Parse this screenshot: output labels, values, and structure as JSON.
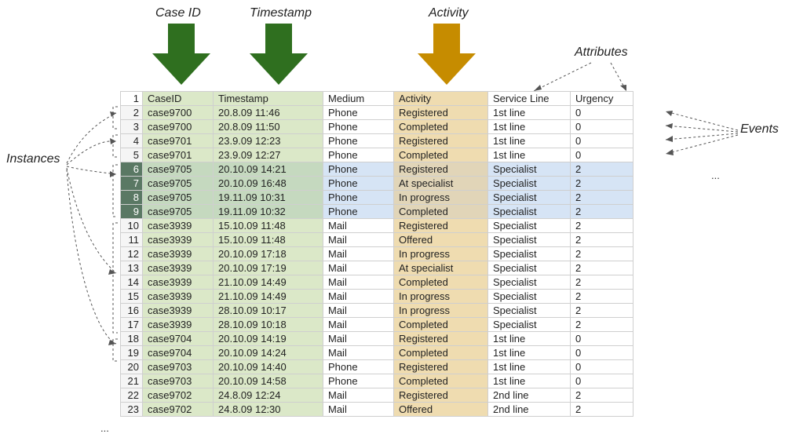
{
  "labels": {
    "case_id": "Case ID",
    "timestamp": "Timestamp",
    "activity": "Activity",
    "attributes": "Attributes",
    "instances": "Instances",
    "events": "Events",
    "ellipsis_left": "...",
    "ellipsis_right": "..."
  },
  "columns": {
    "rownum": "",
    "case": "CaseID",
    "ts": "Timestamp",
    "med": "Medium",
    "act": "Activity",
    "svc": "Service Line",
    "urg": "Urgency"
  },
  "rows": [
    {
      "n": 2,
      "case": "case9700",
      "ts": "20.8.09 11:46",
      "med": "Phone",
      "act": "Registered",
      "svc": "1st line",
      "urg": "0",
      "sel": false
    },
    {
      "n": 3,
      "case": "case9700",
      "ts": "20.8.09 11:50",
      "med": "Phone",
      "act": "Completed",
      "svc": "1st line",
      "urg": "0",
      "sel": false
    },
    {
      "n": 4,
      "case": "case9701",
      "ts": "23.9.09 12:23",
      "med": "Phone",
      "act": "Registered",
      "svc": "1st line",
      "urg": "0",
      "sel": false
    },
    {
      "n": 5,
      "case": "case9701",
      "ts": "23.9.09 12:27",
      "med": "Phone",
      "act": "Completed",
      "svc": "1st line",
      "urg": "0",
      "sel": false
    },
    {
      "n": 6,
      "case": "case9705",
      "ts": "20.10.09 14:21",
      "med": "Phone",
      "act": "Registered",
      "svc": "Specialist",
      "urg": "2",
      "sel": true
    },
    {
      "n": 7,
      "case": "case9705",
      "ts": "20.10.09 16:48",
      "med": "Phone",
      "act": "At specialist",
      "svc": "Specialist",
      "urg": "2",
      "sel": true
    },
    {
      "n": 8,
      "case": "case9705",
      "ts": "19.11.09 10:31",
      "med": "Phone",
      "act": "In progress",
      "svc": "Specialist",
      "urg": "2",
      "sel": true
    },
    {
      "n": 9,
      "case": "case9705",
      "ts": "19.11.09 10:32",
      "med": "Phone",
      "act": "Completed",
      "svc": "Specialist",
      "urg": "2",
      "sel": true
    },
    {
      "n": 10,
      "case": "case3939",
      "ts": "15.10.09 11:48",
      "med": "Mail",
      "act": "Registered",
      "svc": "Specialist",
      "urg": "2",
      "sel": false
    },
    {
      "n": 11,
      "case": "case3939",
      "ts": "15.10.09 11:48",
      "med": "Mail",
      "act": "Offered",
      "svc": "Specialist",
      "urg": "2",
      "sel": false
    },
    {
      "n": 12,
      "case": "case3939",
      "ts": "20.10.09 17:18",
      "med": "Mail",
      "act": "In progress",
      "svc": "Specialist",
      "urg": "2",
      "sel": false
    },
    {
      "n": 13,
      "case": "case3939",
      "ts": "20.10.09 17:19",
      "med": "Mail",
      "act": "At specialist",
      "svc": "Specialist",
      "urg": "2",
      "sel": false
    },
    {
      "n": 14,
      "case": "case3939",
      "ts": "21.10.09 14:49",
      "med": "Mail",
      "act": "Completed",
      "svc": "Specialist",
      "urg": "2",
      "sel": false
    },
    {
      "n": 15,
      "case": "case3939",
      "ts": "21.10.09 14:49",
      "med": "Mail",
      "act": "In progress",
      "svc": "Specialist",
      "urg": "2",
      "sel": false
    },
    {
      "n": 16,
      "case": "case3939",
      "ts": "28.10.09 10:17",
      "med": "Mail",
      "act": "In progress",
      "svc": "Specialist",
      "urg": "2",
      "sel": false
    },
    {
      "n": 17,
      "case": "case3939",
      "ts": "28.10.09 10:18",
      "med": "Mail",
      "act": "Completed",
      "svc": "Specialist",
      "urg": "2",
      "sel": false
    },
    {
      "n": 18,
      "case": "case9704",
      "ts": "20.10.09 14:19",
      "med": "Mail",
      "act": "Registered",
      "svc": "1st line",
      "urg": "0",
      "sel": false
    },
    {
      "n": 19,
      "case": "case9704",
      "ts": "20.10.09 14:24",
      "med": "Mail",
      "act": "Completed",
      "svc": "1st line",
      "urg": "0",
      "sel": false
    },
    {
      "n": 20,
      "case": "case9703",
      "ts": "20.10.09 14:40",
      "med": "Phone",
      "act": "Registered",
      "svc": "1st line",
      "urg": "0",
      "sel": false
    },
    {
      "n": 21,
      "case": "case9703",
      "ts": "20.10.09 14:58",
      "med": "Phone",
      "act": "Completed",
      "svc": "1st line",
      "urg": "0",
      "sel": false
    },
    {
      "n": 22,
      "case": "case9702",
      "ts": "24.8.09 12:24",
      "med": "Mail",
      "act": "Registered",
      "svc": "2nd line",
      "urg": "2",
      "sel": false
    },
    {
      "n": 23,
      "case": "case9702",
      "ts": "24.8.09 12:30",
      "med": "Mail",
      "act": "Offered",
      "svc": "2nd line",
      "urg": "2",
      "sel": false
    }
  ]
}
